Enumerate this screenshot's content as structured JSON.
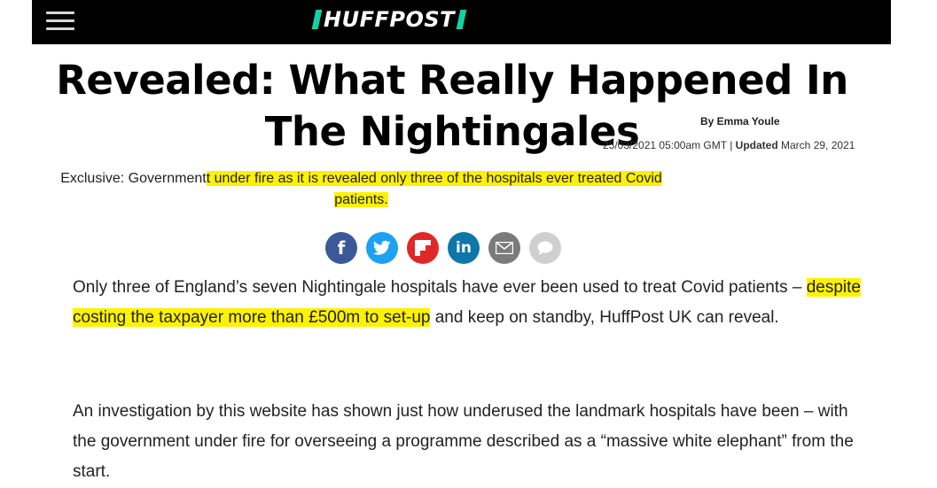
{
  "header": {
    "logo_text": "HUFFPOST"
  },
  "article": {
    "headline": "Revealed: What Really Happened In The Nightingales",
    "author": "By Emma Youle",
    "published": "25/03/2021 05:00am GMT",
    "updated_label": "Updated",
    "updated_date": "March 29, 2021",
    "subheadline_plain": "Exclusive: Government",
    "subheadline_highlight": "t under fire as it is revealed only three of the hospitals ever treated Covid patients.",
    "paragraphs": [
      {
        "before": "Only three of England’s seven Nightingale hospitals have ever been used to treat Covid patients – ",
        "highlight": "despite costing the taxpayer more than £500m to set-up",
        "after": " and keep on standby, HuffPost UK can reveal."
      },
      {
        "text": "An investigation by this website has shown just how underused the landmark hospitals have been – with the government under fire for overseeing a programme described as a “massive white elephant” from the start."
      }
    ]
  },
  "share_buttons": [
    {
      "icon": "facebook-icon",
      "color": "#3b5998",
      "glyph": "f"
    },
    {
      "icon": "twitter-icon",
      "color": "#1da1f2"
    },
    {
      "icon": "flipboard-icon",
      "color": "#e12828"
    },
    {
      "icon": "linkedin-icon",
      "color": "#0e76a8",
      "glyph": "in"
    },
    {
      "icon": "email-icon",
      "color": "#7b7b7b"
    },
    {
      "icon": "comment-icon",
      "color": "#cfcfcf"
    }
  ],
  "colors": {
    "highlight": "#fff200",
    "logo_accent": "#13d1a2",
    "header_bg": "#000000"
  }
}
